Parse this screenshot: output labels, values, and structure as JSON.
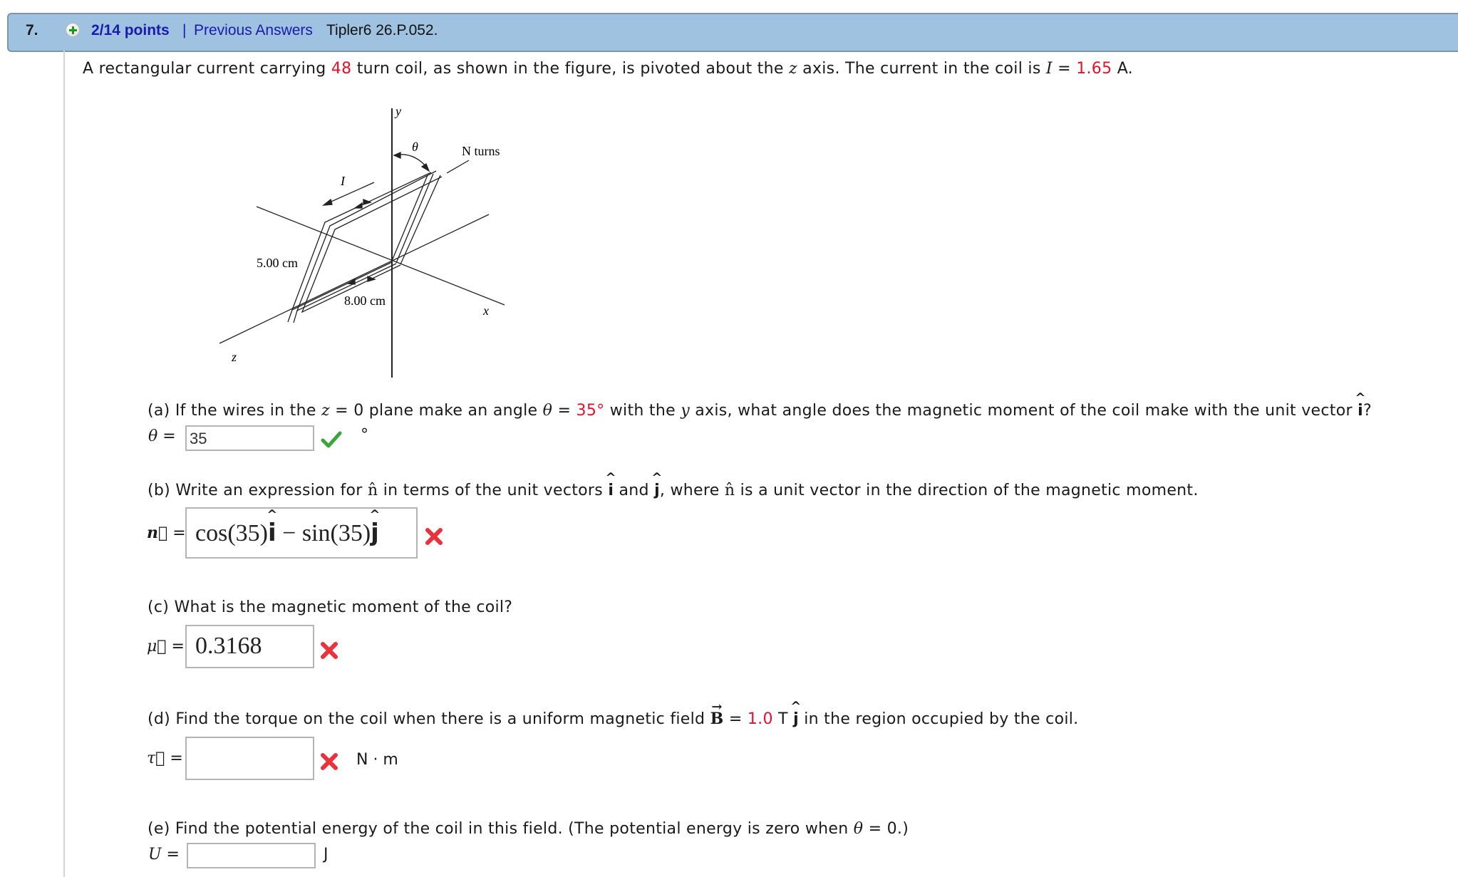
{
  "header": {
    "question_number": "7.",
    "points": "2/14 points",
    "separator": "|",
    "previous_answers_link": "Previous Answers",
    "problem_ref": "Tipler6 26.P.052.",
    "expand_icon": "plus-circle-icon"
  },
  "intro": {
    "part1": "A rectangular current carrying ",
    "turns": "48",
    "part2": " turn coil, as shown in the figure, is pivoted about the ",
    "axis": "z",
    "part3": " axis. The current in the coil is ",
    "current_symbol": "I",
    "eq": " = ",
    "current_value": "1.65",
    "unit": " A."
  },
  "figure": {
    "y_label": "y",
    "x_label": "x",
    "z_label": "z",
    "theta_label": "θ",
    "turns_label": "N turns",
    "current_label": "I",
    "side_label_short": "5.00 cm",
    "side_label_long": "8.00 cm"
  },
  "parts": {
    "a": {
      "q1": "(a) If the wires in the ",
      "z": "z",
      "q2": " = 0 plane make an angle ",
      "theta": "θ",
      "q3": " = ",
      "angle": "35°",
      "q4": " with the ",
      "y": "y",
      "q5": " axis, what angle does the magnetic moment of the coil make with the unit vector ",
      "unit_i": "i",
      "q6": "?",
      "answer_label": "θ",
      "equals": "=",
      "answer_value": "35",
      "status": "correct",
      "status_icon": "checkmark-icon",
      "unit": "°"
    },
    "b": {
      "q1": "(b) Write an expression for ",
      "n": "n̂",
      "q2": " in terms of the unit vectors ",
      "unit_i": "i",
      "and": " and ",
      "unit_j": "j",
      "q3": ", where ",
      "n2": "n̂",
      "q4": " is a unit vector in the direction of the magnetic moment.",
      "answer_label": "n⃗",
      "equals": "=",
      "answer_cos": "cos(35)",
      "answer_i": "i",
      "answer_minus": " − ",
      "answer_sin": "sin(35)",
      "answer_j": "j",
      "status": "incorrect",
      "status_icon": "cross-icon"
    },
    "c": {
      "question": "(c) What is the magnetic moment of the coil?",
      "answer_label": "μ⃗",
      "equals": "=",
      "answer_value": "0.3168",
      "status": "incorrect",
      "status_icon": "cross-icon"
    },
    "d": {
      "q1": "(d) Find the torque on the coil when there is a uniform magnetic field ",
      "B": "B",
      "q2": " = ",
      "field_value": "1.0",
      "q3": " T ",
      "unit_j": "j",
      "q4": " in the region occupied by the coil.",
      "answer_label": "τ⃗",
      "equals": "=",
      "answer_value": "",
      "status": "incorrect",
      "status_icon": "cross-icon",
      "unit": "N · m"
    },
    "e": {
      "q1": "(e) Find the potential energy of the coil in this field. (The potential energy is zero when ",
      "theta": "θ",
      "q2": " = 0.)",
      "answer_label": "U",
      "equals": "=",
      "answer_value": "",
      "unit": "J"
    }
  },
  "colors": {
    "header_bg": "#9ec2df",
    "link": "#1a1ab0",
    "given_value": "#e8102a",
    "correct": "#3aa63a",
    "incorrect": "#e8323c"
  }
}
